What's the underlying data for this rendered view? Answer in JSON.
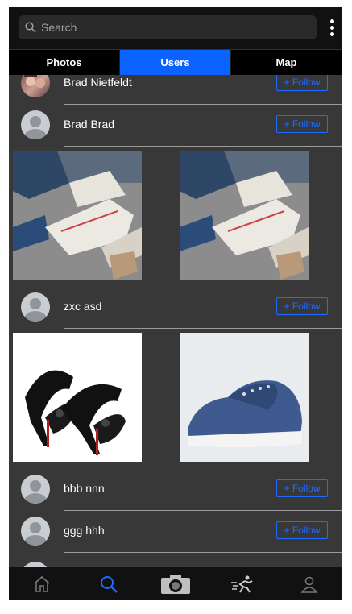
{
  "search": {
    "placeholder": "Search"
  },
  "tabs": [
    {
      "label": "Photos",
      "active": false
    },
    {
      "label": "Users",
      "active": true
    },
    {
      "label": "Map",
      "active": false
    }
  ],
  "users": [
    {
      "name": "Brad Nietfeldt",
      "follow_label": "+ Follow",
      "has_photo": true
    },
    {
      "name": "Brad Brad",
      "follow_label": "+ Follow",
      "has_photo": false
    },
    {
      "name": "zxc asd",
      "follow_label": "+ Follow",
      "has_photo": false
    },
    {
      "name": "bbb nnn",
      "follow_label": "+ Follow",
      "has_photo": false
    },
    {
      "name": "ggg hhh",
      "follow_label": "+ Follow",
      "has_photo": false
    }
  ],
  "posts": [
    {
      "subject": "white-sneakers-photo"
    },
    {
      "subject": "white-sneakers-photo"
    },
    {
      "subject": "black-patent-heels-photo"
    },
    {
      "subject": "blue-canvas-sneaker-photo"
    }
  ],
  "nav": [
    "home-icon",
    "search-icon",
    "camera-icon",
    "runner-icon",
    "profile-icon"
  ],
  "colors": {
    "accent": "#0b63ff",
    "follow": "#1f6bff",
    "background": "#383838",
    "bar": "#111111"
  }
}
